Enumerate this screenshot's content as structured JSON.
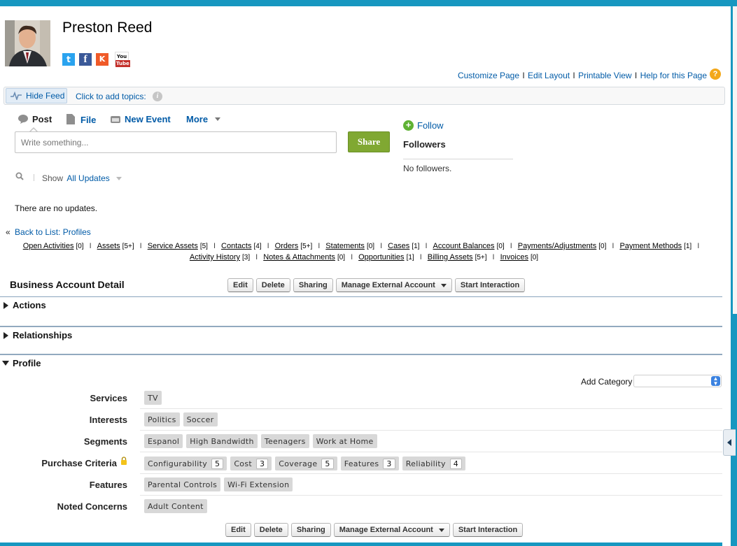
{
  "profile": {
    "name": "Preston Reed",
    "social": [
      {
        "name": "twitter-icon",
        "glyph": "t",
        "color": "#2aa3ef"
      },
      {
        "name": "facebook-icon",
        "glyph": "f",
        "color": "#3b5998"
      },
      {
        "name": "klout-icon",
        "glyph": "K",
        "color": "#f05a28"
      },
      {
        "name": "youtube-icon",
        "glyph": "You",
        "color": "#c4302b"
      }
    ]
  },
  "top_links": [
    "Customize Page",
    "Edit Layout",
    "Printable View",
    "Help for this Page"
  ],
  "feedbar": {
    "hide_feed": "Hide Feed",
    "topics": "Click to add topics:"
  },
  "publisher": {
    "post": "Post",
    "file": "File",
    "new_event": "New Event",
    "more": "More",
    "placeholder": "Write something...",
    "share": "Share"
  },
  "followers": {
    "follow": "Follow",
    "title": "Followers",
    "empty": "No followers."
  },
  "feed": {
    "show_label": "Show",
    "filter": "All Updates",
    "no_updates": "There are no updates."
  },
  "back_to_list": {
    "prefix": "«",
    "label": "Back to List: Profiles"
  },
  "related_lists": {
    "line1": [
      {
        "label": "Open Activities",
        "count": "[0]"
      },
      {
        "label": "Assets",
        "count": "[5+]"
      },
      {
        "label": "Service Assets",
        "count": "[5]"
      },
      {
        "label": "Contacts",
        "count": "[4]"
      },
      {
        "label": "Orders",
        "count": "[5+]"
      },
      {
        "label": "Statements",
        "count": "[0]"
      },
      {
        "label": "Cases",
        "count": "[1]"
      },
      {
        "label": "Account Balances",
        "count": "[0]"
      },
      {
        "label": "Payments/Adjustments",
        "count": "[0]"
      },
      {
        "label": "Payment Methods",
        "count": "[1]"
      }
    ],
    "line2": [
      {
        "label": "Activity History",
        "count": "[3]"
      },
      {
        "label": "Notes & Attachments",
        "count": "[0]"
      },
      {
        "label": "Opportunities",
        "count": "[1]"
      },
      {
        "label": "Billing Assets",
        "count": "[5+]"
      },
      {
        "label": "Invoices",
        "count": "[0]"
      }
    ]
  },
  "detail": {
    "title": "Business Account Detail",
    "buttons": {
      "edit": "Edit",
      "delete": "Delete",
      "sharing": "Sharing",
      "manage": "Manage External Account",
      "interaction": "Start Interaction"
    }
  },
  "sections": {
    "actions": "Actions",
    "relationships": "Relationships",
    "profile": "Profile"
  },
  "add_category": {
    "label": "Add Category",
    "value": ""
  },
  "profile_rows": [
    {
      "label": "Services",
      "tags": [
        {
          "text": "TV"
        }
      ]
    },
    {
      "label": "Interests",
      "tags": [
        {
          "text": "Politics"
        },
        {
          "text": "Soccer"
        }
      ]
    },
    {
      "label": "Segments",
      "tags": [
        {
          "text": "Espanol"
        },
        {
          "text": "High Bandwidth"
        },
        {
          "text": "Teenagers"
        },
        {
          "text": "Work at Home"
        }
      ]
    },
    {
      "label": "Purchase Criteria",
      "locked": true,
      "tags": [
        {
          "text": "Configurability",
          "score": "5"
        },
        {
          "text": "Cost",
          "score": "3"
        },
        {
          "text": "Coverage",
          "score": "5"
        },
        {
          "text": "Features",
          "score": "3"
        },
        {
          "text": "Reliability",
          "score": "4"
        }
      ]
    },
    {
      "label": "Features",
      "tags": [
        {
          "text": "Parental Controls"
        },
        {
          "text": "Wi-Fi Extension"
        }
      ]
    },
    {
      "label": "Noted Concerns",
      "tags": [
        {
          "text": "Adult Content"
        }
      ]
    }
  ]
}
